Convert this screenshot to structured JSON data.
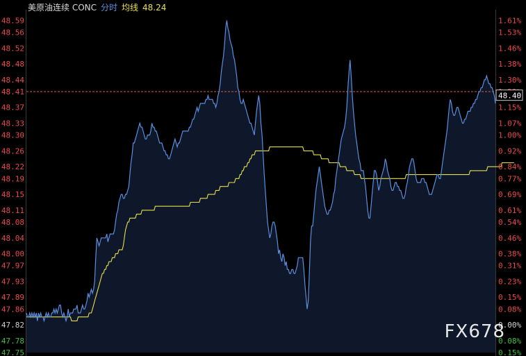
{
  "header": {
    "instrument": "美原油连续 CONC",
    "mode": "分时",
    "avg_label": "均线",
    "avg_value": "48.24"
  },
  "watermark": "FX678",
  "colors": {
    "background": "#000000",
    "price_line": "#5b8fe0",
    "avg_line": "#e8e04a",
    "up": "#e84a4a",
    "down": "#3fbf3f",
    "neutral": "#d0d0d0",
    "ref_line": "#e05a3a",
    "grid": "#2a2a2a",
    "area_fill": "rgba(40,70,120,0.35)"
  },
  "chart_data": {
    "type": "line",
    "title": "",
    "xlabel": "",
    "ylabel": "",
    "ylim": [
      47.75,
      48.61
    ],
    "grid": false,
    "legend": "top-left",
    "last_price": "48.40",
    "last_value": 48.4,
    "reference_value": 48.41,
    "left_ticks": [
      {
        "label": "48.59",
        "value": 48.59,
        "color": "up"
      },
      {
        "label": "48.56",
        "value": 48.56,
        "color": "up"
      },
      {
        "label": "48.52",
        "value": 48.52,
        "color": "up"
      },
      {
        "label": "48.48",
        "value": 48.48,
        "color": "up"
      },
      {
        "label": "48.44",
        "value": 48.44,
        "color": "up"
      },
      {
        "label": "48.41",
        "value": 48.41,
        "color": "up"
      },
      {
        "label": "48.37",
        "value": 48.37,
        "color": "up"
      },
      {
        "label": "48.33",
        "value": 48.33,
        "color": "up"
      },
      {
        "label": "48.30",
        "value": 48.3,
        "color": "up"
      },
      {
        "label": "48.26",
        "value": 48.26,
        "color": "up"
      },
      {
        "label": "48.22",
        "value": 48.22,
        "color": "up"
      },
      {
        "label": "48.19",
        "value": 48.19,
        "color": "up"
      },
      {
        "label": "48.15",
        "value": 48.15,
        "color": "up"
      },
      {
        "label": "48.11",
        "value": 48.11,
        "color": "up"
      },
      {
        "label": "48.08",
        "value": 48.08,
        "color": "up"
      },
      {
        "label": "48.04",
        "value": 48.04,
        "color": "up"
      },
      {
        "label": "48.00",
        "value": 48.0,
        "color": "up"
      },
      {
        "label": "47.97",
        "value": 47.97,
        "color": "up"
      },
      {
        "label": "47.93",
        "value": 47.93,
        "color": "up"
      },
      {
        "label": "47.89",
        "value": 47.89,
        "color": "up"
      },
      {
        "label": "47.86",
        "value": 47.86,
        "color": "up"
      },
      {
        "label": "47.82",
        "value": 47.82,
        "color": "neutral"
      },
      {
        "label": "47.78",
        "value": 47.78,
        "color": "down"
      },
      {
        "label": "47.75",
        "value": 47.75,
        "color": "down"
      }
    ],
    "right_ticks": [
      {
        "label": "1.61%",
        "value": 48.59,
        "color": "up"
      },
      {
        "label": "1.53%",
        "value": 48.56,
        "color": "up"
      },
      {
        "label": "1.46%",
        "value": 48.52,
        "color": "up"
      },
      {
        "label": "1.38%",
        "value": 48.48,
        "color": "up"
      },
      {
        "label": "1.30%",
        "value": 48.44,
        "color": "up"
      },
      {
        "label": "1.23%",
        "value": 48.41,
        "color": "up"
      },
      {
        "label": "1.15%",
        "value": 48.37,
        "color": "up"
      },
      {
        "label": "1.07%",
        "value": 48.33,
        "color": "up"
      },
      {
        "label": "1.00%",
        "value": 48.3,
        "color": "up"
      },
      {
        "label": "0.92%",
        "value": 48.26,
        "color": "up"
      },
      {
        "label": "0.84%",
        "value": 48.22,
        "color": "up"
      },
      {
        "label": "0.77%",
        "value": 48.19,
        "color": "up"
      },
      {
        "label": "0.69%",
        "value": 48.15,
        "color": "up"
      },
      {
        "label": "0.61%",
        "value": 48.11,
        "color": "up"
      },
      {
        "label": "0.54%",
        "value": 48.08,
        "color": "up"
      },
      {
        "label": "0.46%",
        "value": 48.04,
        "color": "up"
      },
      {
        "label": "0.38%",
        "value": 48.0,
        "color": "up"
      },
      {
        "label": "0.31%",
        "value": 47.97,
        "color": "up"
      },
      {
        "label": "0.23%",
        "value": 47.93,
        "color": "up"
      },
      {
        "label": "0.15%",
        "value": 47.89,
        "color": "up"
      },
      {
        "label": "0.08%",
        "value": 47.86,
        "color": "up"
      },
      {
        "label": "0.00%",
        "value": 47.82,
        "color": "neutral"
      },
      {
        "label": "0.08%",
        "value": 47.78,
        "color": "down"
      },
      {
        "label": "0.15%",
        "value": 47.75,
        "color": "down"
      }
    ],
    "series": [
      {
        "role": "price",
        "values": [
          47.85,
          47.84,
          47.84,
          47.85,
          47.84,
          47.85,
          47.84,
          47.85,
          47.84,
          47.85,
          47.83,
          47.85,
          47.84,
          47.85,
          47.84,
          47.84,
          47.83,
          47.84,
          47.85,
          47.84,
          47.85,
          47.84,
          47.84,
          47.85,
          47.85,
          47.86,
          47.85,
          47.86,
          47.85,
          47.86,
          47.87,
          47.87,
          47.85,
          47.84,
          47.85,
          47.84,
          47.83,
          47.84,
          47.86,
          47.84,
          47.85,
          47.85,
          47.85,
          47.86,
          47.86,
          47.86,
          47.87,
          47.85,
          47.85,
          47.85,
          47.86,
          47.87,
          47.86,
          47.86,
          47.87,
          47.88,
          47.9,
          47.89,
          47.9,
          47.91,
          47.9,
          47.91,
          47.93,
          47.99,
          48.04,
          48.03,
          48.02,
          48.03,
          48.04,
          48.04,
          48.04,
          48.04,
          48.04,
          48.05,
          48.03,
          48.04,
          48.05,
          48.05,
          48.05,
          48.05,
          48.06,
          48.08,
          48.1,
          48.11,
          48.13,
          48.14,
          48.15,
          48.15,
          48.14,
          48.14,
          48.15,
          48.15,
          48.16,
          48.17,
          48.2,
          48.23,
          48.25,
          48.28,
          48.28,
          48.29,
          48.3,
          48.31,
          48.32,
          48.33,
          48.32,
          48.32,
          48.31,
          48.3,
          48.29,
          48.29,
          48.3,
          48.3,
          48.3,
          48.31,
          48.33,
          48.32,
          48.32,
          48.31,
          48.31,
          48.3,
          48.29,
          48.28,
          48.28,
          48.28,
          48.27,
          48.26,
          48.26,
          48.25,
          48.25,
          48.24,
          48.24,
          48.25,
          48.26,
          48.27,
          48.28,
          48.29,
          48.28,
          48.27,
          48.28,
          48.28,
          48.29,
          48.3,
          48.31,
          48.31,
          48.31,
          48.31,
          48.31,
          48.31,
          48.32,
          48.32,
          48.33,
          48.34,
          48.34,
          48.35,
          48.36,
          48.37,
          48.36,
          48.37,
          48.38,
          48.38,
          48.38,
          48.38,
          48.38,
          48.39,
          48.39,
          48.4,
          48.39,
          48.39,
          48.39,
          48.39,
          48.38,
          48.38,
          48.37,
          48.38,
          48.4,
          48.41,
          48.43,
          48.46,
          48.48,
          48.5,
          48.53,
          48.57,
          48.59,
          48.57,
          48.56,
          48.54,
          48.53,
          48.52,
          48.5,
          48.49,
          48.47,
          48.45,
          48.42,
          48.41,
          48.39,
          48.38,
          48.38,
          48.39,
          48.38,
          48.37,
          48.36,
          48.35,
          48.34,
          48.33,
          48.33,
          48.32,
          48.31,
          48.3,
          48.33,
          48.36,
          48.38,
          48.4,
          48.38,
          48.33,
          48.3,
          48.25,
          48.2,
          48.16,
          48.12,
          48.08,
          48.06,
          48.04,
          48.05,
          48.07,
          48.08,
          48.08,
          48.07,
          48.05,
          48.03,
          48.0,
          48.01,
          47.99,
          47.98,
          48.0,
          47.99,
          47.97,
          47.98,
          47.96,
          47.96,
          47.95,
          47.95,
          47.96,
          47.96,
          47.95,
          47.95,
          47.96,
          47.97,
          47.99,
          47.99,
          47.99,
          47.99,
          47.99,
          47.96,
          47.92,
          47.89,
          47.86,
          47.88,
          47.95,
          48.03,
          48.07,
          48.07,
          48.1,
          48.13,
          48.16,
          48.18,
          48.2,
          48.22,
          48.2,
          48.18,
          48.16,
          48.14,
          48.12,
          48.11,
          48.1,
          48.1,
          48.11,
          48.11,
          48.12,
          48.13,
          48.15,
          48.16,
          48.19,
          48.21,
          48.23,
          48.25,
          48.27,
          48.29,
          48.3,
          48.31,
          48.32,
          48.34,
          48.37,
          48.42,
          48.46,
          48.49,
          48.45,
          48.4,
          48.36,
          48.33,
          48.3,
          48.28,
          48.26,
          48.24,
          48.23,
          48.21,
          48.21,
          48.21,
          48.19,
          48.17,
          48.14,
          48.11,
          48.09,
          48.09,
          48.12,
          48.15,
          48.18,
          48.21,
          48.21,
          48.2,
          48.18,
          48.16,
          48.17,
          48.19,
          48.2,
          48.21,
          48.22,
          48.24,
          48.23,
          48.21,
          48.2,
          48.19,
          48.17,
          48.16,
          48.16,
          48.17,
          48.18,
          48.18,
          48.17,
          48.17,
          48.16,
          48.16,
          48.15,
          48.14,
          48.14,
          48.15,
          48.17,
          48.18,
          48.2,
          48.22,
          48.23,
          48.24,
          48.24,
          48.23,
          48.21,
          48.19,
          48.18,
          48.18,
          48.18,
          48.18,
          48.19,
          48.19,
          48.19,
          48.18,
          48.18,
          48.17,
          48.16,
          48.15,
          48.15,
          48.15,
          48.16,
          48.17,
          48.18,
          48.19,
          48.2,
          48.2,
          48.19,
          48.19,
          48.21,
          48.23,
          48.25,
          48.27,
          48.29,
          48.31,
          48.34,
          48.37,
          48.39,
          48.38,
          48.36,
          48.35,
          48.35,
          48.36,
          48.37,
          48.37,
          48.36,
          48.35,
          48.34,
          48.33,
          48.33,
          48.34,
          48.34,
          48.35,
          48.36,
          48.36,
          48.36,
          48.37,
          48.37,
          48.38,
          48.38,
          48.39,
          48.39,
          48.4,
          48.41,
          48.41,
          48.42,
          48.42,
          48.43,
          48.44,
          48.44,
          48.45,
          48.44,
          48.43,
          48.43,
          48.42,
          48.42,
          48.41,
          48.4,
          48.38
        ]
      },
      {
        "role": "average",
        "values": [
          47.84,
          47.84,
          47.84,
          47.84,
          47.84,
          47.84,
          47.84,
          47.84,
          47.84,
          47.84,
          47.84,
          47.84,
          47.84,
          47.84,
          47.84,
          47.84,
          47.84,
          47.84,
          47.84,
          47.84,
          47.84,
          47.84,
          47.84,
          47.84,
          47.84,
          47.84,
          47.84,
          47.84,
          47.84,
          47.84,
          47.84,
          47.84,
          47.84,
          47.84,
          47.84,
          47.84,
          47.84,
          47.84,
          47.84,
          47.84,
          47.84,
          47.83,
          47.83,
          47.83,
          47.83,
          47.83,
          47.83,
          47.84,
          47.84,
          47.84,
          47.84,
          47.84,
          47.84,
          47.84,
          47.84,
          47.84,
          47.84,
          47.85,
          47.85,
          47.85,
          47.86,
          47.87,
          47.88,
          47.89,
          47.9,
          47.91,
          47.92,
          47.93,
          47.94,
          47.95,
          47.95,
          47.96,
          47.96,
          47.97,
          47.97,
          47.98,
          47.98,
          47.98,
          47.99,
          47.99,
          47.99,
          48.0,
          48.0,
          48.0,
          48.01,
          48.01,
          48.01,
          48.01,
          48.02,
          48.04,
          48.06,
          48.07,
          48.08,
          48.08,
          48.09,
          48.09,
          48.09,
          48.09,
          48.09,
          48.09,
          48.1,
          48.1,
          48.1,
          48.1,
          48.1,
          48.11,
          48.11,
          48.11,
          48.11,
          48.11,
          48.11,
          48.11,
          48.11,
          48.11,
          48.11,
          48.11,
          48.11,
          48.12,
          48.12,
          48.12,
          48.12,
          48.12,
          48.12,
          48.12,
          48.12,
          48.12,
          48.12,
          48.12,
          48.12,
          48.12,
          48.12,
          48.12,
          48.12,
          48.12,
          48.12,
          48.12,
          48.12,
          48.12,
          48.12,
          48.12,
          48.12,
          48.12,
          48.12,
          48.12,
          48.12,
          48.12,
          48.12,
          48.12,
          48.12,
          48.13,
          48.13,
          48.13,
          48.13,
          48.13,
          48.13,
          48.13,
          48.13,
          48.13,
          48.14,
          48.14,
          48.14,
          48.14,
          48.14,
          48.14,
          48.14,
          48.15,
          48.15,
          48.15,
          48.15,
          48.15,
          48.15,
          48.15,
          48.16,
          48.16,
          48.16,
          48.16,
          48.17,
          48.17,
          48.17,
          48.17,
          48.17,
          48.17,
          48.17,
          48.17,
          48.18,
          48.18,
          48.18,
          48.18,
          48.18,
          48.18,
          48.19,
          48.19,
          48.19,
          48.19,
          48.2,
          48.2,
          48.21,
          48.21,
          48.22,
          48.22,
          48.22,
          48.23,
          48.23,
          48.24,
          48.24,
          48.25,
          48.25,
          48.25,
          48.26,
          48.26,
          48.26,
          48.26,
          48.26,
          48.26,
          48.26,
          48.26,
          48.26,
          48.26,
          48.26,
          48.26,
          48.26,
          48.27,
          48.27,
          48.27,
          48.27,
          48.27,
          48.27,
          48.27,
          48.27,
          48.27,
          48.27,
          48.27,
          48.27,
          48.27,
          48.27,
          48.27,
          48.27,
          48.27,
          48.27,
          48.27,
          48.27,
          48.27,
          48.27,
          48.27,
          48.27,
          48.27,
          48.27,
          48.27,
          48.27,
          48.27,
          48.27,
          48.27,
          48.26,
          48.26,
          48.26,
          48.26,
          48.26,
          48.26,
          48.26,
          48.26,
          48.26,
          48.25,
          48.25,
          48.25,
          48.25,
          48.25,
          48.25,
          48.25,
          48.24,
          48.24,
          48.24,
          48.24,
          48.24,
          48.24,
          48.24,
          48.23,
          48.23,
          48.23,
          48.23,
          48.23,
          48.23,
          48.23,
          48.23,
          48.23,
          48.23,
          48.22,
          48.22,
          48.22,
          48.22,
          48.22,
          48.22,
          48.21,
          48.21,
          48.21,
          48.21,
          48.21,
          48.21,
          48.21,
          48.2,
          48.2,
          48.2,
          48.2,
          48.2,
          48.2,
          48.19,
          48.19,
          48.19,
          48.19,
          48.19,
          48.19,
          48.19,
          48.19,
          48.19,
          48.19,
          48.19,
          48.19,
          48.19,
          48.19,
          48.19,
          48.19,
          48.19,
          48.19,
          48.19,
          48.19,
          48.19,
          48.19,
          48.19,
          48.19,
          48.19,
          48.19,
          48.19,
          48.19,
          48.19,
          48.19,
          48.19,
          48.19,
          48.19,
          48.19,
          48.19,
          48.19,
          48.19,
          48.19,
          48.19,
          48.19,
          48.19,
          48.2,
          48.2,
          48.2,
          48.2,
          48.2,
          48.2,
          48.2,
          48.2,
          48.2,
          48.2,
          48.2,
          48.2,
          48.2,
          48.2,
          48.2,
          48.2,
          48.2,
          48.2,
          48.2,
          48.2,
          48.2,
          48.2,
          48.2,
          48.2,
          48.2,
          48.2,
          48.2,
          48.2,
          48.2,
          48.2,
          48.2,
          48.2,
          48.2,
          48.2,
          48.2,
          48.2,
          48.2,
          48.2,
          48.2,
          48.2,
          48.2,
          48.2,
          48.2,
          48.2,
          48.2,
          48.2,
          48.2,
          48.2,
          48.2,
          48.2,
          48.2,
          48.2,
          48.2,
          48.2,
          48.2,
          48.2,
          48.2,
          48.2,
          48.21,
          48.21,
          48.21,
          48.21,
          48.21,
          48.21,
          48.21,
          48.21,
          48.21,
          48.21,
          48.21,
          48.21,
          48.21,
          48.21,
          48.21,
          48.21,
          48.22,
          48.22,
          48.22,
          48.22,
          48.22,
          48.22,
          48.22,
          48.22,
          48.22,
          48.22,
          48.22,
          48.22,
          48.22,
          48.23,
          48.23,
          48.23,
          48.23,
          48.23,
          48.23,
          48.23,
          48.23,
          48.23,
          48.23,
          48.23,
          48.23
        ]
      }
    ]
  }
}
